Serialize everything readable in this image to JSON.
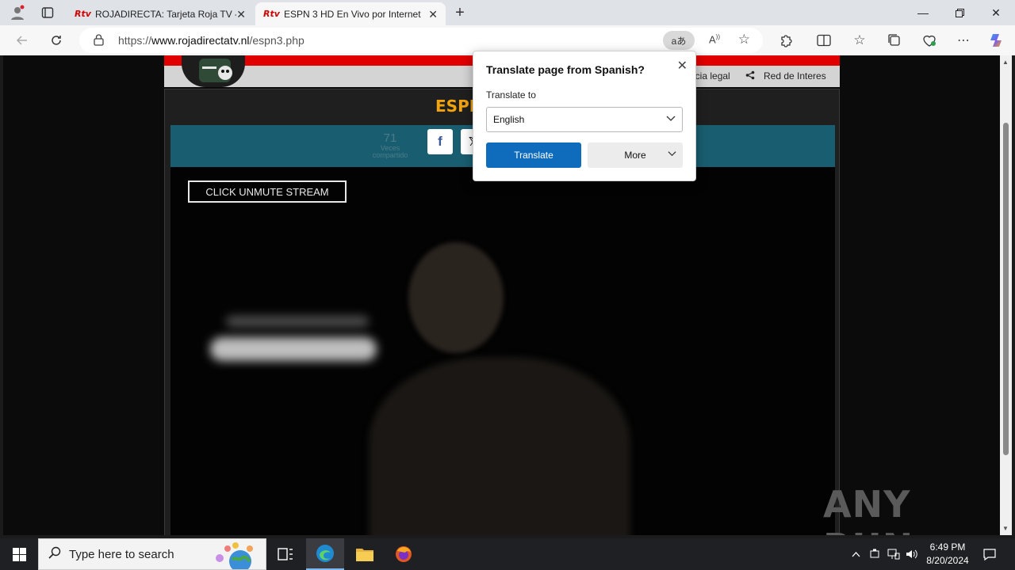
{
  "browser": {
    "tabs": [
      {
        "label": "ROJADIRECTA: Tarjeta Roja TV - P",
        "favicon": "Rtv"
      },
      {
        "label": "ESPN 3 HD En Vivo por Internet",
        "favicon": "Rtv"
      }
    ],
    "url_prefix": "https://",
    "url_host": "www.rojadirectatv.nl",
    "url_path": "/espn3.php",
    "translate_icon": "aあ"
  },
  "page": {
    "header_links": [
      "ncia legal",
      "Red de Interes"
    ],
    "channel_title": "ESPN",
    "share_count": "71",
    "share_label_1": "Veces",
    "share_label_2": "compartido",
    "unmute_label": "CLICK UNMUTE STREAM",
    "watermark": "ANY RUN"
  },
  "translate_popup": {
    "title": "Translate page from Spanish?",
    "translate_to_label": "Translate to",
    "selected_language": "English",
    "translate_button": "Translate",
    "more_button": "More"
  },
  "taskbar": {
    "search_placeholder": "Type here to search",
    "time": "6:49 PM",
    "date": "8/20/2024"
  },
  "colors": {
    "accent_blue": "#0f6cbd",
    "channel_orange": "#f2a40a",
    "brand_red": "#e00000",
    "share_teal": "#195e70"
  }
}
